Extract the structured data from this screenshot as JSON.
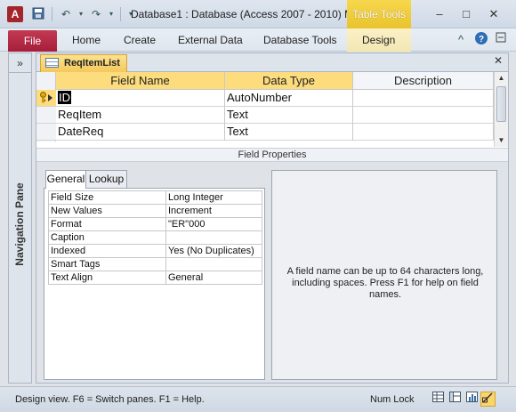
{
  "titlebar": {
    "app_icon": "A",
    "window_title": "Database1 : Database (Access 2007 - 2010) M",
    "contextual_group": "Table Tools",
    "qat": {
      "save_icon": "save-icon",
      "undo_icon": "undo-icon",
      "redo_icon": "redo-icon"
    },
    "controls": {
      "minimize": "–",
      "restore": "□",
      "close": "✕"
    }
  },
  "ribbon": {
    "file_tab": "File",
    "tabs": [
      {
        "label": "Home"
      },
      {
        "label": "Create"
      },
      {
        "label": "External Data"
      },
      {
        "label": "Database Tools"
      },
      {
        "label": "Design"
      }
    ],
    "minimize_ribbon_icon": "^",
    "help_icon": "?"
  },
  "navigation_pane": {
    "label": "Navigation Pane",
    "toggle": "»"
  },
  "document": {
    "tab_label": "ReqItemList",
    "close": "✕",
    "grid": {
      "columns": [
        "Field Name",
        "Data Type",
        "Description"
      ],
      "rows": [
        {
          "field": "ID",
          "type": "AutoNumber",
          "description": "",
          "primary_key": true,
          "current": true
        },
        {
          "field": "ReqItem",
          "type": "Text",
          "description": ""
        },
        {
          "field": "DateReq",
          "type": "Text",
          "description": ""
        }
      ]
    },
    "field_properties": {
      "title": "Field Properties",
      "tabs": [
        "General",
        "Lookup"
      ],
      "properties": [
        {
          "name": "Field Size",
          "value": "Long Integer"
        },
        {
          "name": "New Values",
          "value": "Increment"
        },
        {
          "name": "Format",
          "value": "\"ER\"000"
        },
        {
          "name": "Caption",
          "value": ""
        },
        {
          "name": "Indexed",
          "value": "Yes (No Duplicates)"
        },
        {
          "name": "Smart Tags",
          "value": ""
        },
        {
          "name": "Text Align",
          "value": "General"
        }
      ],
      "help_text": "A field name can be up to 64 characters long, including spaces. Press F1 for help on field names."
    }
  },
  "statusbar": {
    "text": "Design view.  F6 = Switch panes.  F1 = Help.",
    "num_lock": "Num Lock"
  }
}
